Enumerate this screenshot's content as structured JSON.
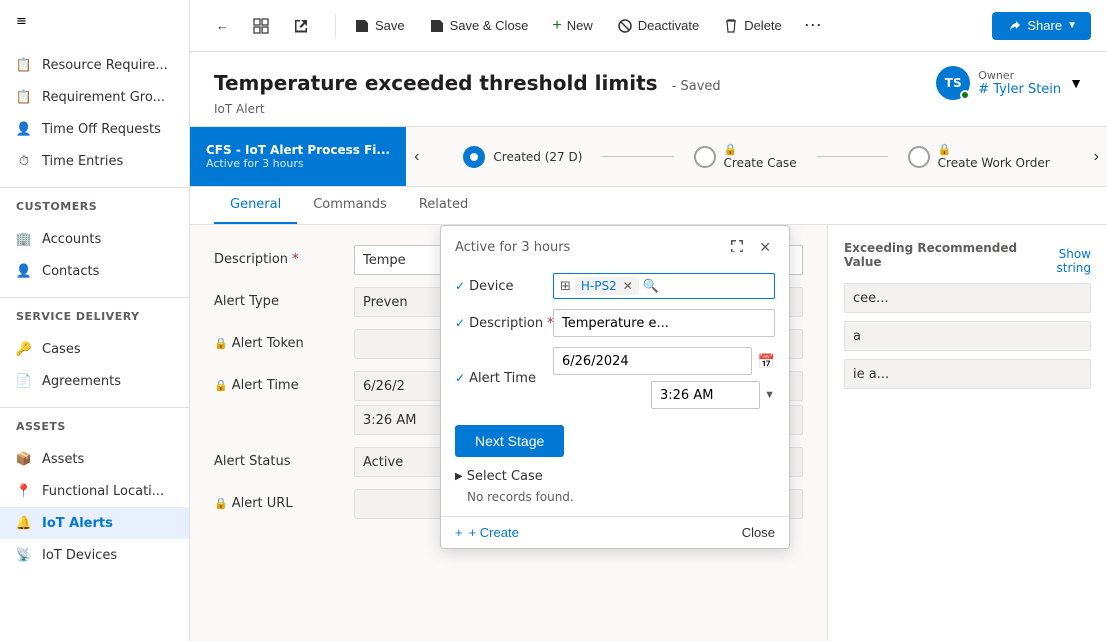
{
  "sidebar": {
    "hamburger_icon": "≡",
    "top_items": [
      {
        "id": "resource-requirements",
        "label": "Resource Require...",
        "icon": "📋"
      },
      {
        "id": "requirement-groups",
        "label": "Requirement Gro...",
        "icon": "📋"
      },
      {
        "id": "time-off-requests",
        "label": "Time Off Requests",
        "icon": "👤"
      },
      {
        "id": "time-entries",
        "label": "Time Entries",
        "icon": "⏱"
      }
    ],
    "sections": [
      {
        "id": "customers",
        "label": "Customers",
        "items": [
          {
            "id": "accounts",
            "label": "Accounts",
            "icon": "🏢"
          },
          {
            "id": "contacts",
            "label": "Contacts",
            "icon": "👤"
          }
        ]
      },
      {
        "id": "service-delivery",
        "label": "Service Delivery",
        "items": [
          {
            "id": "cases",
            "label": "Cases",
            "icon": "🔑"
          },
          {
            "id": "agreements",
            "label": "Agreements",
            "icon": "📄"
          }
        ]
      },
      {
        "id": "assets",
        "label": "Assets",
        "items": [
          {
            "id": "assets",
            "label": "Assets",
            "icon": "📦"
          },
          {
            "id": "functional-locations",
            "label": "Functional Locati...",
            "icon": "📍"
          },
          {
            "id": "iot-alerts",
            "label": "IoT Alerts",
            "icon": "🔔",
            "active": true
          },
          {
            "id": "iot-devices",
            "label": "IoT Devices",
            "icon": "📡"
          }
        ]
      }
    ]
  },
  "toolbar": {
    "back_label": "←",
    "view_icon": "view",
    "new_window_icon": "new-window",
    "save_label": "Save",
    "save_close_label": "Save & Close",
    "new_label": "New",
    "deactivate_label": "Deactivate",
    "delete_label": "Delete",
    "more_label": "⋯",
    "share_label": "Share"
  },
  "record": {
    "title": "Temperature exceeded threshold limits",
    "saved_status": "- Saved",
    "subtitle": "IoT Alert",
    "owner_initials": "TS",
    "owner_label": "Owner",
    "owner_name": "# Tyler Stein"
  },
  "process_bar": {
    "active_stage": "CFS - IoT Alert Process Fi...",
    "active_time": "Active for 3 hours",
    "steps": [
      {
        "id": "created",
        "label": "Created (27 D)",
        "active": true,
        "locked": false
      },
      {
        "id": "create-case",
        "label": "Create Case",
        "active": false,
        "locked": true
      },
      {
        "id": "create-work-order",
        "label": "Create Work Order",
        "active": false,
        "locked": true
      }
    ]
  },
  "popup": {
    "title": "Active for 3 hours",
    "device_label": "Device",
    "device_value": "H-PS2",
    "device_check": "✓",
    "description_label": "Description",
    "description_required": "*",
    "description_check": "✓",
    "description_value": "Temperature e...",
    "alert_time_label": "Alert Time",
    "alert_time_check": "✓",
    "alert_time_date": "6/26/2024",
    "alert_time_hour": "3:26 AM",
    "next_stage_label": "Next Stage",
    "select_case_label": "Select Case",
    "no_records_label": "No records found.",
    "create_label": "+ Create",
    "close_label": "Close"
  },
  "tabs": [
    {
      "id": "general",
      "label": "General",
      "active": true
    },
    {
      "id": "commands",
      "label": "Commands",
      "active": false
    },
    {
      "id": "related",
      "label": "Related",
      "active": false
    }
  ],
  "form": {
    "description_label": "Description",
    "description_required": "*",
    "description_value": "Tempe",
    "alert_type_label": "Alert Type",
    "alert_type_value": "Preven",
    "alert_token_label": "Alert Token",
    "alert_token_lock": "🔒",
    "alert_token_value": "",
    "alert_time_label": "Alert Time",
    "alert_time_lock": "🔒",
    "alert_time_value": "6/26/2",
    "alert_time_hour": "3:26 AM",
    "alert_status_label": "Alert Status",
    "alert_status_value": "Active",
    "alert_url_label": "Alert URL",
    "alert_url_lock": "🔒",
    "show_string_label": "Show string",
    "exceeding_label": "Exceeding Recommended Value",
    "cee_value": "cee...",
    "e_a_value": "a",
    "ie_a_value": "ie a..."
  }
}
